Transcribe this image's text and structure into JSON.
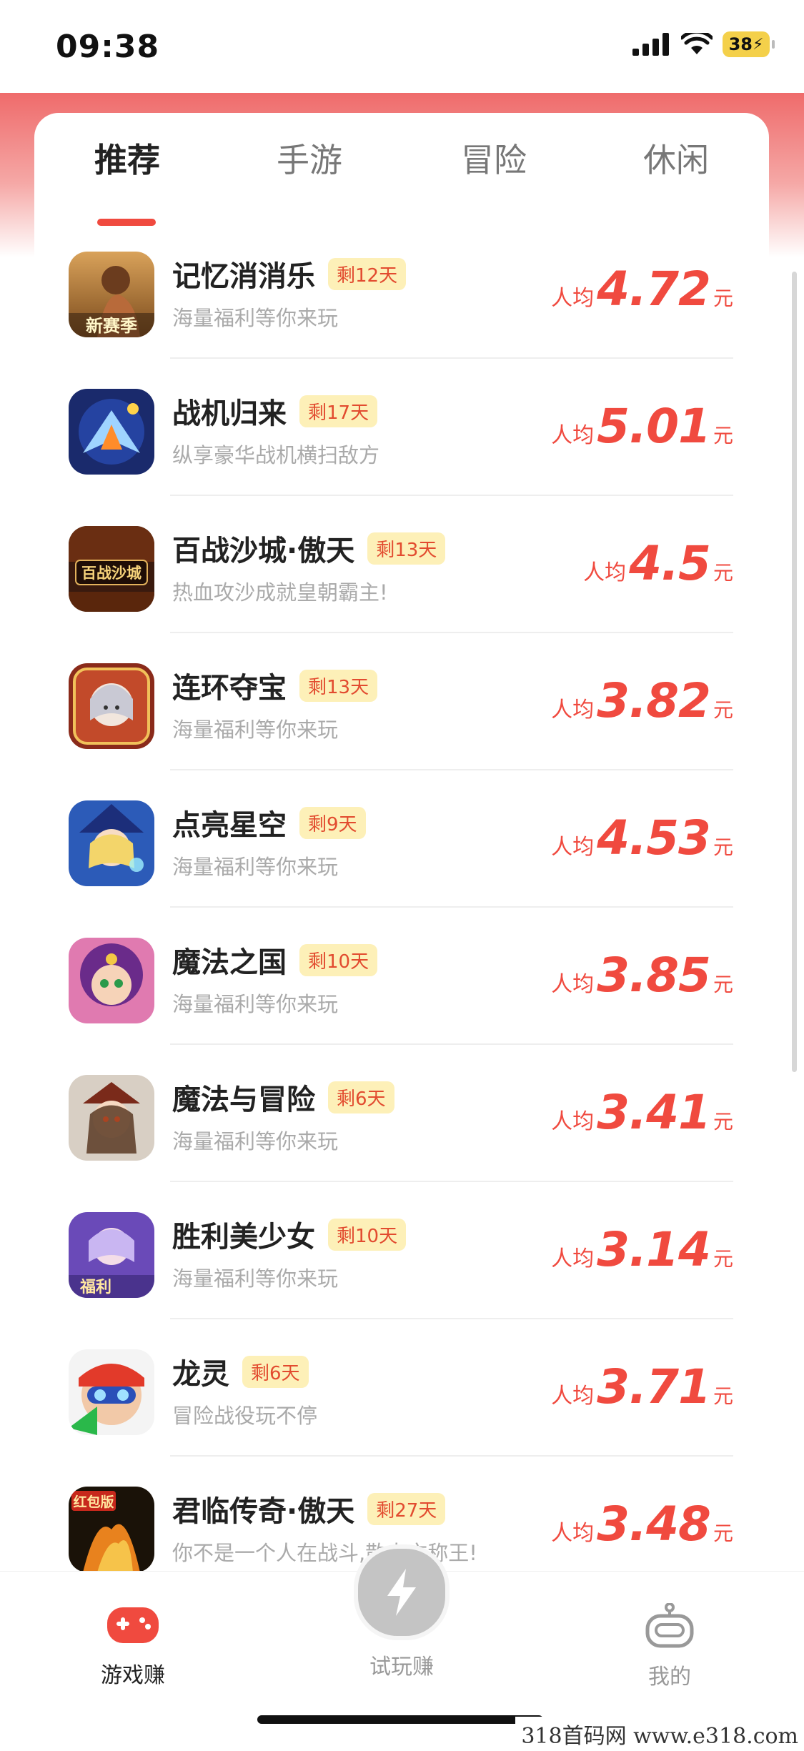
{
  "status_bar": {
    "time": "09:38",
    "battery": "38"
  },
  "tabs": [
    {
      "label": "推荐",
      "active": true
    },
    {
      "label": "手游",
      "active": false
    },
    {
      "label": "冒险",
      "active": false
    },
    {
      "label": "休闲",
      "active": false
    }
  ],
  "reward_prefix": "人均",
  "reward_unit": "元",
  "games": [
    {
      "name": "记忆消消乐",
      "badge": "剩12天",
      "desc": "海量福利等你来玩",
      "amount": "4.72",
      "icon": "game-icon-memory"
    },
    {
      "name": "战机归来",
      "badge": "剩17天",
      "desc": "纵享豪华战机横扫敌方",
      "amount": "5.01",
      "icon": "game-icon-fighter"
    },
    {
      "name": "百战沙城·傲天",
      "badge": "剩13天",
      "desc": "热血攻沙成就皇朝霸主!",
      "amount": "4.5",
      "icon": "game-icon-sandcity"
    },
    {
      "name": "连环夺宝",
      "badge": "剩13天",
      "desc": "海量福利等你来玩",
      "amount": "3.82",
      "icon": "game-icon-treasure"
    },
    {
      "name": "点亮星空",
      "badge": "剩9天",
      "desc": "海量福利等你来玩",
      "amount": "4.53",
      "icon": "game-icon-starsky"
    },
    {
      "name": "魔法之国",
      "badge": "剩10天",
      "desc": "海量福利等你来玩",
      "amount": "3.85",
      "icon": "game-icon-magicland"
    },
    {
      "name": "魔法与冒险",
      "badge": "剩6天",
      "desc": "海量福利等你来玩",
      "amount": "3.41",
      "icon": "game-icon-magicadventure"
    },
    {
      "name": "胜利美少女",
      "badge": "剩10天",
      "desc": "海量福利等你来玩",
      "amount": "3.14",
      "icon": "game-icon-victorygirl"
    },
    {
      "name": "龙灵",
      "badge": "剩6天",
      "desc": "冒险战役玩不停",
      "amount": "3.71",
      "icon": "game-icon-dragonspirit"
    },
    {
      "name": "君临传奇·傲天",
      "badge": "剩27天",
      "desc": "你不是一个人在战斗,散人亦称王!",
      "amount": "3.48",
      "icon": "game-icon-legend"
    }
  ],
  "icon_texts": {
    "memory": "新赛季",
    "sandcity": "百战沙城",
    "victorygirl": "福利",
    "legend": "红包版"
  },
  "bottom_nav": {
    "game": "游戏赚",
    "trial": "试玩赚",
    "mine": "我的"
  },
  "watermark": "318首码网  www.e318.com",
  "colors": {
    "accent": "#f04a3f",
    "badge_bg": "#fdf0b8"
  }
}
